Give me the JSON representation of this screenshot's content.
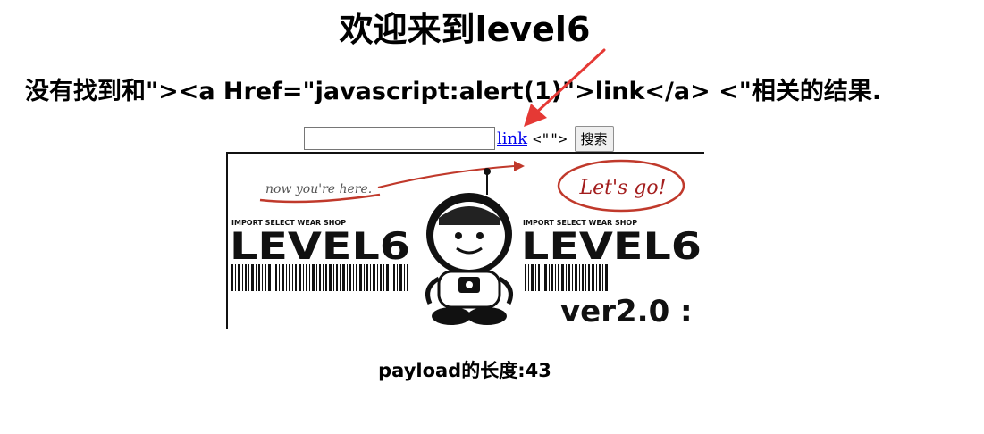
{
  "page": {
    "title": "欢迎来到level6",
    "result_prefix": "没有找到和\"><a Href=\"javascript:alert(1)\">link</a> <\"相关的结果."
  },
  "search": {
    "input_value": "",
    "injected_link_text": "link",
    "trailing_text": "<\"\">",
    "button_label": "搜索"
  },
  "banner": {
    "handwriting_left": "now you're here.",
    "speech_bubble": "Let's go!",
    "shop_caption_left": "IMPORT SELECT WEAR SHOP",
    "logo_left": "LEVEL6",
    "shop_caption_right": "IMPORT SELECT WEAR SHOP",
    "logo_right": "LEVEL6",
    "version": "ver2.0 :"
  },
  "footer": {
    "payload_length": "payload的长度:43"
  },
  "colors": {
    "link": "#0000ee",
    "annotation_arrow": "#e53935",
    "banner_red": "#c0392b"
  },
  "icons": {
    "annotation": "red-arrow-icon",
    "robot": "robot-mascot-icon"
  }
}
